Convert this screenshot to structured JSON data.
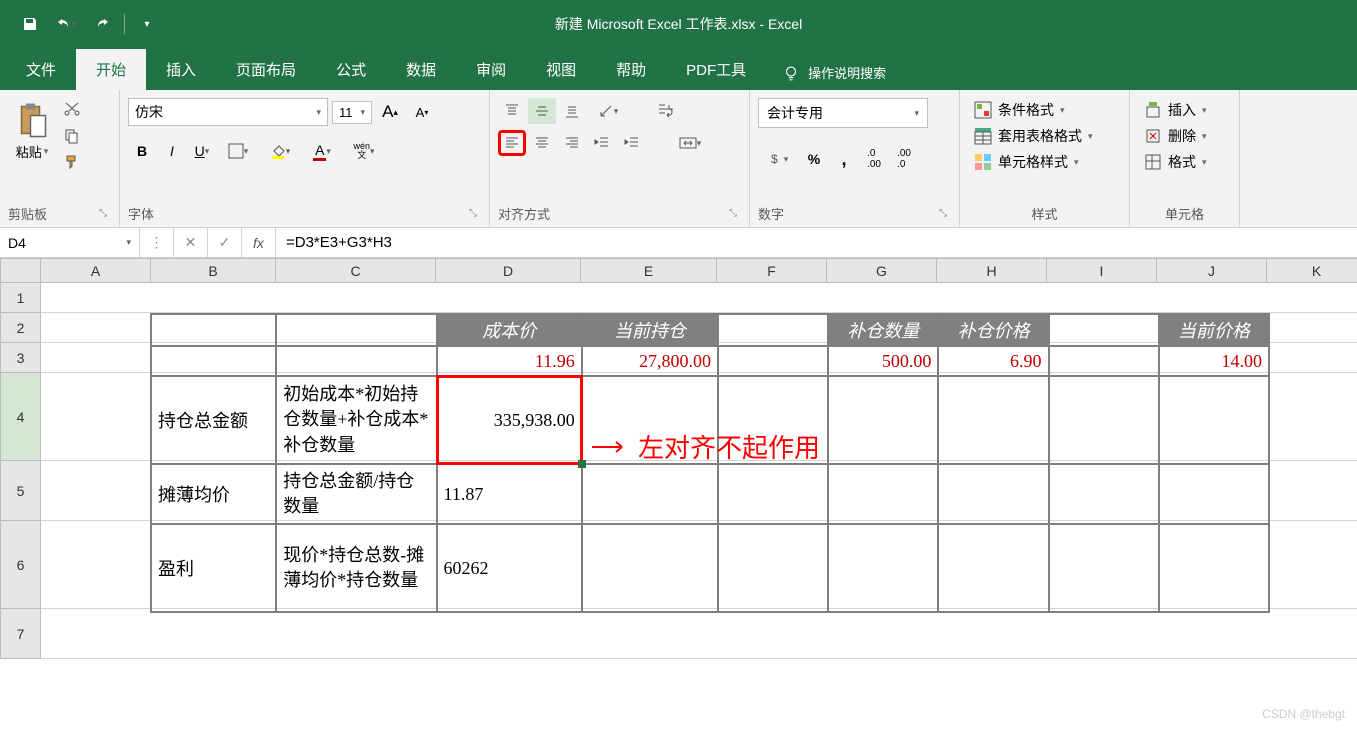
{
  "window": {
    "title": "新建 Microsoft Excel 工作表.xlsx  -  Excel"
  },
  "tabs": {
    "file": "文件",
    "home": "开始",
    "insert": "插入",
    "layout": "页面布局",
    "formulas": "公式",
    "data": "数据",
    "review": "审阅",
    "view": "视图",
    "help": "帮助",
    "pdf": "PDF工具",
    "tellme": "操作说明搜索"
  },
  "ribbon": {
    "clipboard": {
      "paste": "粘贴",
      "label": "剪贴板"
    },
    "font": {
      "name": "仿宋",
      "size": "11",
      "label": "字体",
      "wen": "wén",
      "wen2": "文"
    },
    "alignment": {
      "label": "对齐方式"
    },
    "number": {
      "format": "会计专用",
      "label": "数字"
    },
    "styles": {
      "cond": "条件格式",
      "table": "套用表格格式",
      "cell": "单元格样式",
      "label": "样式"
    },
    "cells": {
      "insert": "插入",
      "delete": "删除",
      "format": "格式",
      "label": "单元格"
    }
  },
  "formula_bar": {
    "cell": "D4",
    "formula": "=D3*E3+G3*H3"
  },
  "columns": [
    "A",
    "B",
    "C",
    "D",
    "E",
    "F",
    "G",
    "H",
    "I",
    "J",
    "K"
  ],
  "rows": [
    "1",
    "2",
    "3",
    "4",
    "5",
    "6",
    "7"
  ],
  "sheet": {
    "headers": {
      "d2": "成本价",
      "e2": "当前持仓",
      "g2": "补仓数量",
      "h2": "补仓价格",
      "j2": "当前价格"
    },
    "row3": {
      "d": "11.96",
      "e": "27,800.00",
      "g": "500.00",
      "h": "6.90",
      "j": "14.00"
    },
    "row4": {
      "b": "持仓总金额",
      "c": "初始成本*初始持仓数量+补仓成本*补仓数量",
      "d": "335,938.00"
    },
    "row5": {
      "b": "摊薄均价",
      "c": "持仓总金额/持仓数量",
      "d": "11.87"
    },
    "row6": {
      "b": "盈利",
      "c": "现价*持仓总数-摊薄均价*持仓数量",
      "d": "60262"
    }
  },
  "annotation": "左对齐不起作用",
  "watermark": "CSDN @thebgt"
}
